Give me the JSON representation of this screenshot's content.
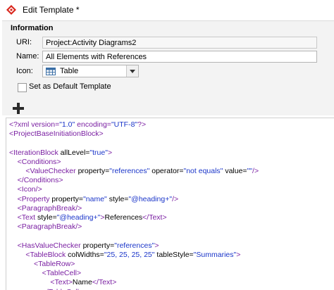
{
  "window": {
    "title": "Edit Template *"
  },
  "info": {
    "section": "Information",
    "uri_label": "URI:",
    "uri_value": "Project:Activity Diagrams2",
    "name_label": "Name:",
    "name_value": "All Elements with References",
    "icon_label": "Icon:",
    "icon_value": "Table",
    "default_label": "Set as Default Template"
  },
  "code": [
    [
      [
        "pi",
        "<?xml version="
      ],
      [
        "s",
        "\"1.0\""
      ],
      [
        "pi",
        " encoding="
      ],
      [
        "s",
        "\"UTF-8\""
      ],
      [
        "pi",
        "?>"
      ]
    ],
    [
      [
        "t",
        "<ProjectBaseInitiationBlock>"
      ]
    ],
    [],
    [
      [
        "t",
        "<IterationBlock"
      ],
      [
        "a",
        " allLevel="
      ],
      [
        "s",
        "\"true\""
      ],
      [
        "t",
        ">"
      ]
    ],
    [
      [
        "t",
        "    <Conditions>"
      ]
    ],
    [
      [
        "t",
        "        <ValueChecker"
      ],
      [
        "a",
        " property="
      ],
      [
        "s",
        "\"references\""
      ],
      [
        "a",
        " operator="
      ],
      [
        "s",
        "\"not equals\""
      ],
      [
        "a",
        " value="
      ],
      [
        "s",
        "\"\""
      ],
      [
        "t",
        "/>"
      ]
    ],
    [
      [
        "t",
        "    </Conditions>"
      ]
    ],
    [
      [
        "t",
        "    <Icon/>"
      ]
    ],
    [
      [
        "t",
        "    <Property"
      ],
      [
        "a",
        " property="
      ],
      [
        "s",
        "\"name\""
      ],
      [
        "a",
        " style="
      ],
      [
        "s",
        "\"@heading+\""
      ],
      [
        "t",
        "/>"
      ]
    ],
    [
      [
        "t",
        "    <ParagraphBreak/>"
      ]
    ],
    [
      [
        "t",
        "    <Text"
      ],
      [
        "a",
        " style="
      ],
      [
        "s",
        "\"@heading+\""
      ],
      [
        "t",
        ">"
      ],
      [
        "x",
        "References"
      ],
      [
        "t",
        "</Text>"
      ]
    ],
    [
      [
        "t",
        "    <ParagraphBreak/>"
      ]
    ],
    [],
    [
      [
        "t",
        "    <HasValueChecker"
      ],
      [
        "a",
        " property="
      ],
      [
        "s",
        "\"references\""
      ],
      [
        "t",
        ">"
      ]
    ],
    [
      [
        "t",
        "        <TableBlock"
      ],
      [
        "a",
        " colWidths="
      ],
      [
        "s",
        "\"25, 25, 25, 25\""
      ],
      [
        "a",
        " tableStyle="
      ],
      [
        "s",
        "\"Summaries\""
      ],
      [
        "t",
        ">"
      ]
    ],
    [
      [
        "t",
        "            <TableRow>"
      ]
    ],
    [
      [
        "t",
        "                <TableCell>"
      ]
    ],
    [
      [
        "t",
        "                    <Text>"
      ],
      [
        "x",
        "Name"
      ],
      [
        "t",
        "</Text>"
      ]
    ],
    [
      [
        "t",
        "                </TableCell>"
      ]
    ]
  ]
}
